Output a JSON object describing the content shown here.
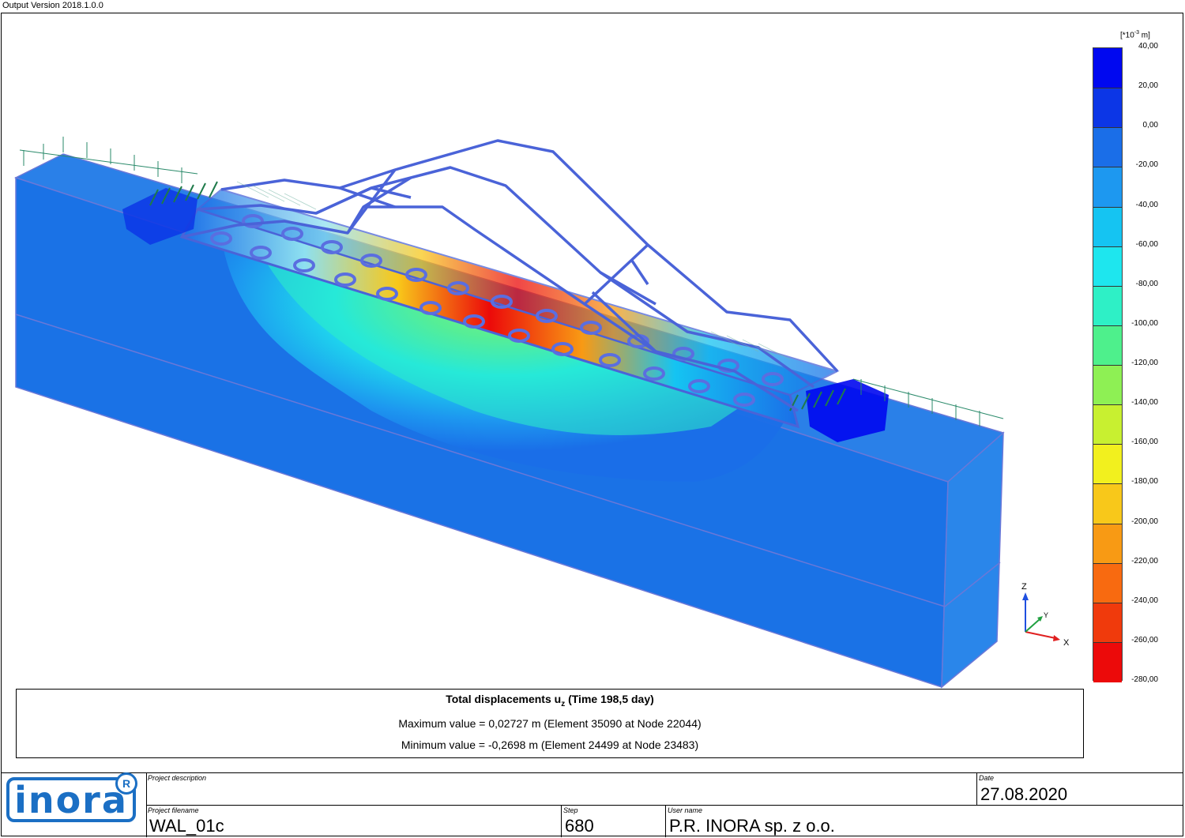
{
  "version": "Output Version 2018.1.0.0",
  "legend": {
    "unit_prefix": "[*10",
    "unit_exp": "-3",
    "unit_suffix": " m]",
    "labels": [
      "40,00",
      "20,00",
      "0,00",
      "-20,00",
      "-40,00",
      "-60,00",
      "-80,00",
      "-100,00",
      "-120,00",
      "-140,00",
      "-160,00",
      "-180,00",
      "-200,00",
      "-220,00",
      "-240,00",
      "-260,00",
      "-280,00"
    ],
    "colors": [
      "#0008f0",
      "#0c36e6",
      "#1a6ee8",
      "#1d98f0",
      "#15c4f2",
      "#1ee6ee",
      "#2ef0c6",
      "#4ef08c",
      "#8ef054",
      "#c8f030",
      "#f2f01e",
      "#f8c81a",
      "#f89a14",
      "#f86a10",
      "#f03a0c",
      "#ec0a0a"
    ]
  },
  "axes": {
    "z": "Z",
    "y": "Y",
    "x": "X"
  },
  "result": {
    "title_prefix": "Total displacements u",
    "title_sub": "z",
    "title_suffix": " (Time 198,5 day)",
    "max_line": "Maximum value = 0,02727 m (Element 35090 at Node 22044)",
    "min_line": "Minimum value = -0,2698 m (Element 24499 at Node 23483)"
  },
  "titleblock": {
    "logo_text": "inora",
    "logo_reg": "R",
    "project_description_caption": "Project description",
    "project_description": "",
    "date_caption": "Date",
    "date": "27.08.2020",
    "project_filename_caption": "Project filename",
    "project_filename": "WAL_01c",
    "step_caption": "Step",
    "step": "680",
    "user_caption": "User name",
    "user": "P.R. INORA sp. z o.o."
  }
}
